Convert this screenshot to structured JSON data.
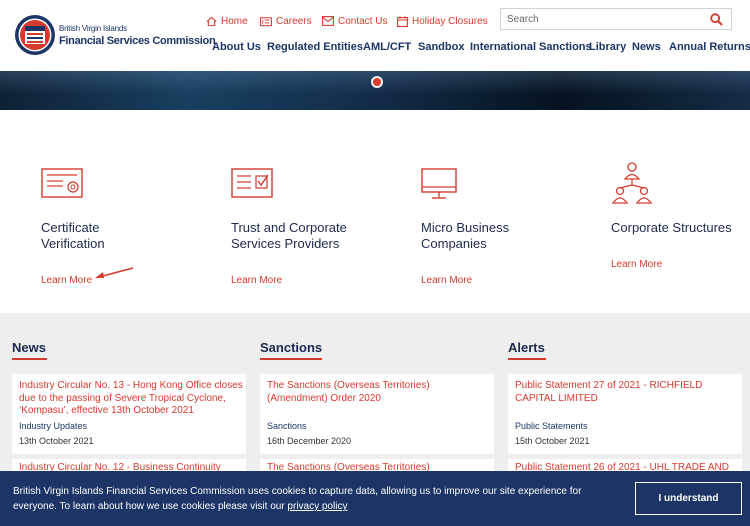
{
  "brand": {
    "line1": "British Virgin Islands",
    "line2": "Financial Services Commission"
  },
  "utility_links": [
    {
      "label": "Home",
      "icon": "home-icon"
    },
    {
      "label": "Careers",
      "icon": "id-card-icon"
    },
    {
      "label": "Contact Us",
      "icon": "envelope-icon"
    },
    {
      "label": "Holiday Closures",
      "icon": "calendar-icon"
    }
  ],
  "search": {
    "placeholder": "Search"
  },
  "nav": [
    "About Us",
    "Regulated Entities",
    "AML/CFT",
    "Sandbox",
    "International Sanctions",
    "Library",
    "News",
    "Annual Returns"
  ],
  "services": [
    {
      "title": "Certificate Verification",
      "link": "Learn More",
      "icon": "certificate-icon"
    },
    {
      "title": "Trust and Corporate Services Providers",
      "link": "Learn More",
      "icon": "checklist-icon"
    },
    {
      "title": "Micro Business Companies",
      "link": "Learn More",
      "icon": "monitor-icon"
    },
    {
      "title": "Corporate Structures",
      "link": "Learn More",
      "icon": "org-chart-icon"
    }
  ],
  "columns": [
    {
      "heading": "News",
      "cards": [
        {
          "title": "Industry Circular No. 13 - Hong Kong Office closes due to the passing of Severe Tropical Cyclone, ‘Kompasu’, effective 13th October 2021",
          "category": "Industry Updates",
          "date": "13th October 2021"
        },
        {
          "title": "Industry Circular No. 12 - Business Continuity"
        }
      ]
    },
    {
      "heading": "Sanctions",
      "cards": [
        {
          "title": "The Sanctions (Overseas Territories) (Amendment) Order 2020",
          "category": "Sanctions",
          "date": "16th December 2020"
        },
        {
          "title": "The Sanctions (Overseas Territories)"
        }
      ]
    },
    {
      "heading": "Alerts",
      "cards": [
        {
          "title": "Public Statement 27 of 2021 - RICHFIELD CAPITAL LIMITED",
          "category": "Public Statements",
          "date": "15th October 2021"
        },
        {
          "title": "Public Statement 26 of 2021 - UHL TRADE AND"
        }
      ]
    }
  ],
  "cookie": {
    "message": "British Virgin Islands Financial Services Commission uses cookies to capture data, allowing us to improve our site experience for everyone. To learn about how we use cookies please visit our",
    "link": "privacy policy",
    "button": "I understand"
  },
  "colors": {
    "accent": "#d63a2f",
    "navy": "#1c3566",
    "panel": "#eeeeee"
  }
}
